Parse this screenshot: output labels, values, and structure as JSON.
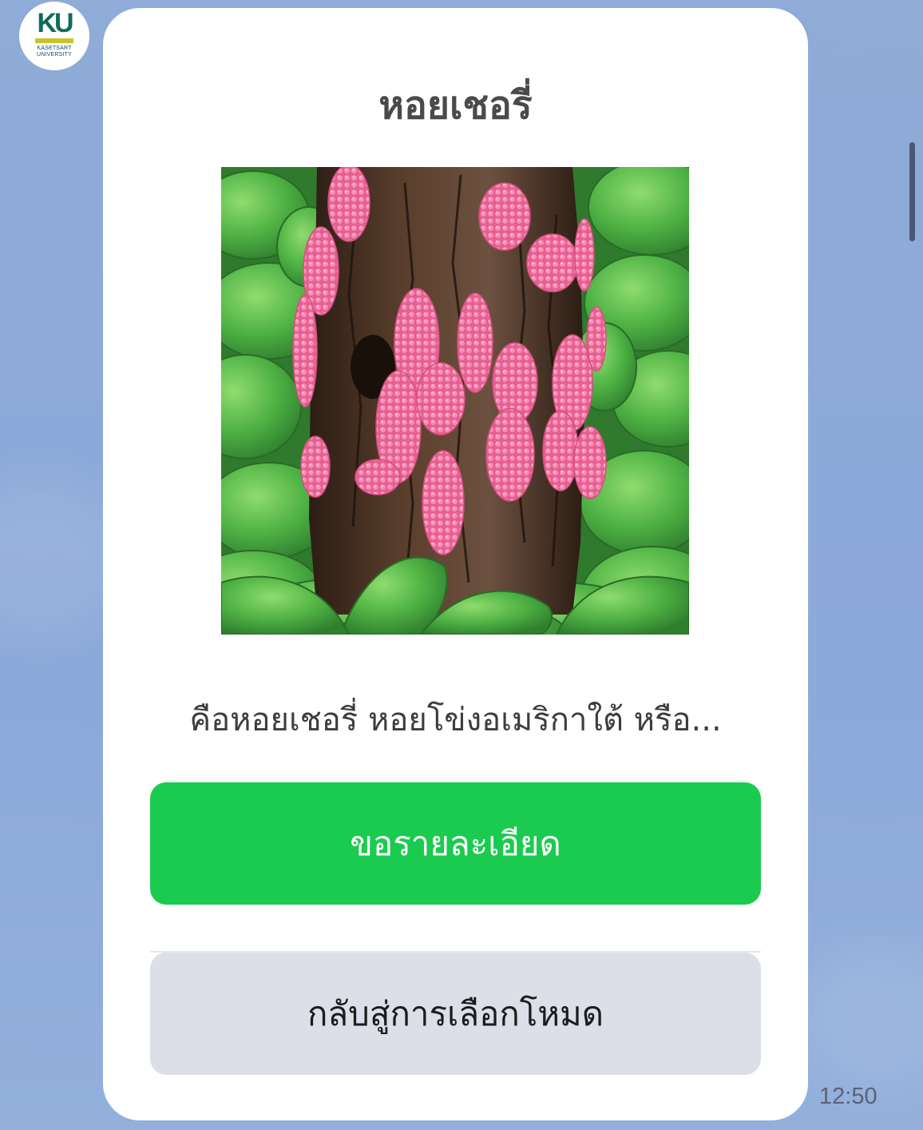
{
  "chat": {
    "avatar": {
      "logo_text": "KU",
      "logo_subtext_line1": "KASETSART",
      "logo_subtext_line2": "UNIVERSITY"
    },
    "message_time": "12:50"
  },
  "card": {
    "title": "หอยเชอรี่",
    "image": {
      "subject": "pink apple snail egg clusters on a tree trunk surrounded by water lettuce leaves",
      "colors": {
        "eggs": "#ee6a9a",
        "bark": "#4a3324",
        "leaves": "#5cbf4a"
      }
    },
    "description": "คือหอยเชอรี่ หอยโข่งอเมริกาใต้ หรือ...",
    "primary_button": {
      "label": "ขอรายละเอียด",
      "color": "#1bcb4f"
    },
    "secondary_button": {
      "label": "กลับสู่การเลือกโหมด",
      "color": "#dcdfe8"
    }
  }
}
